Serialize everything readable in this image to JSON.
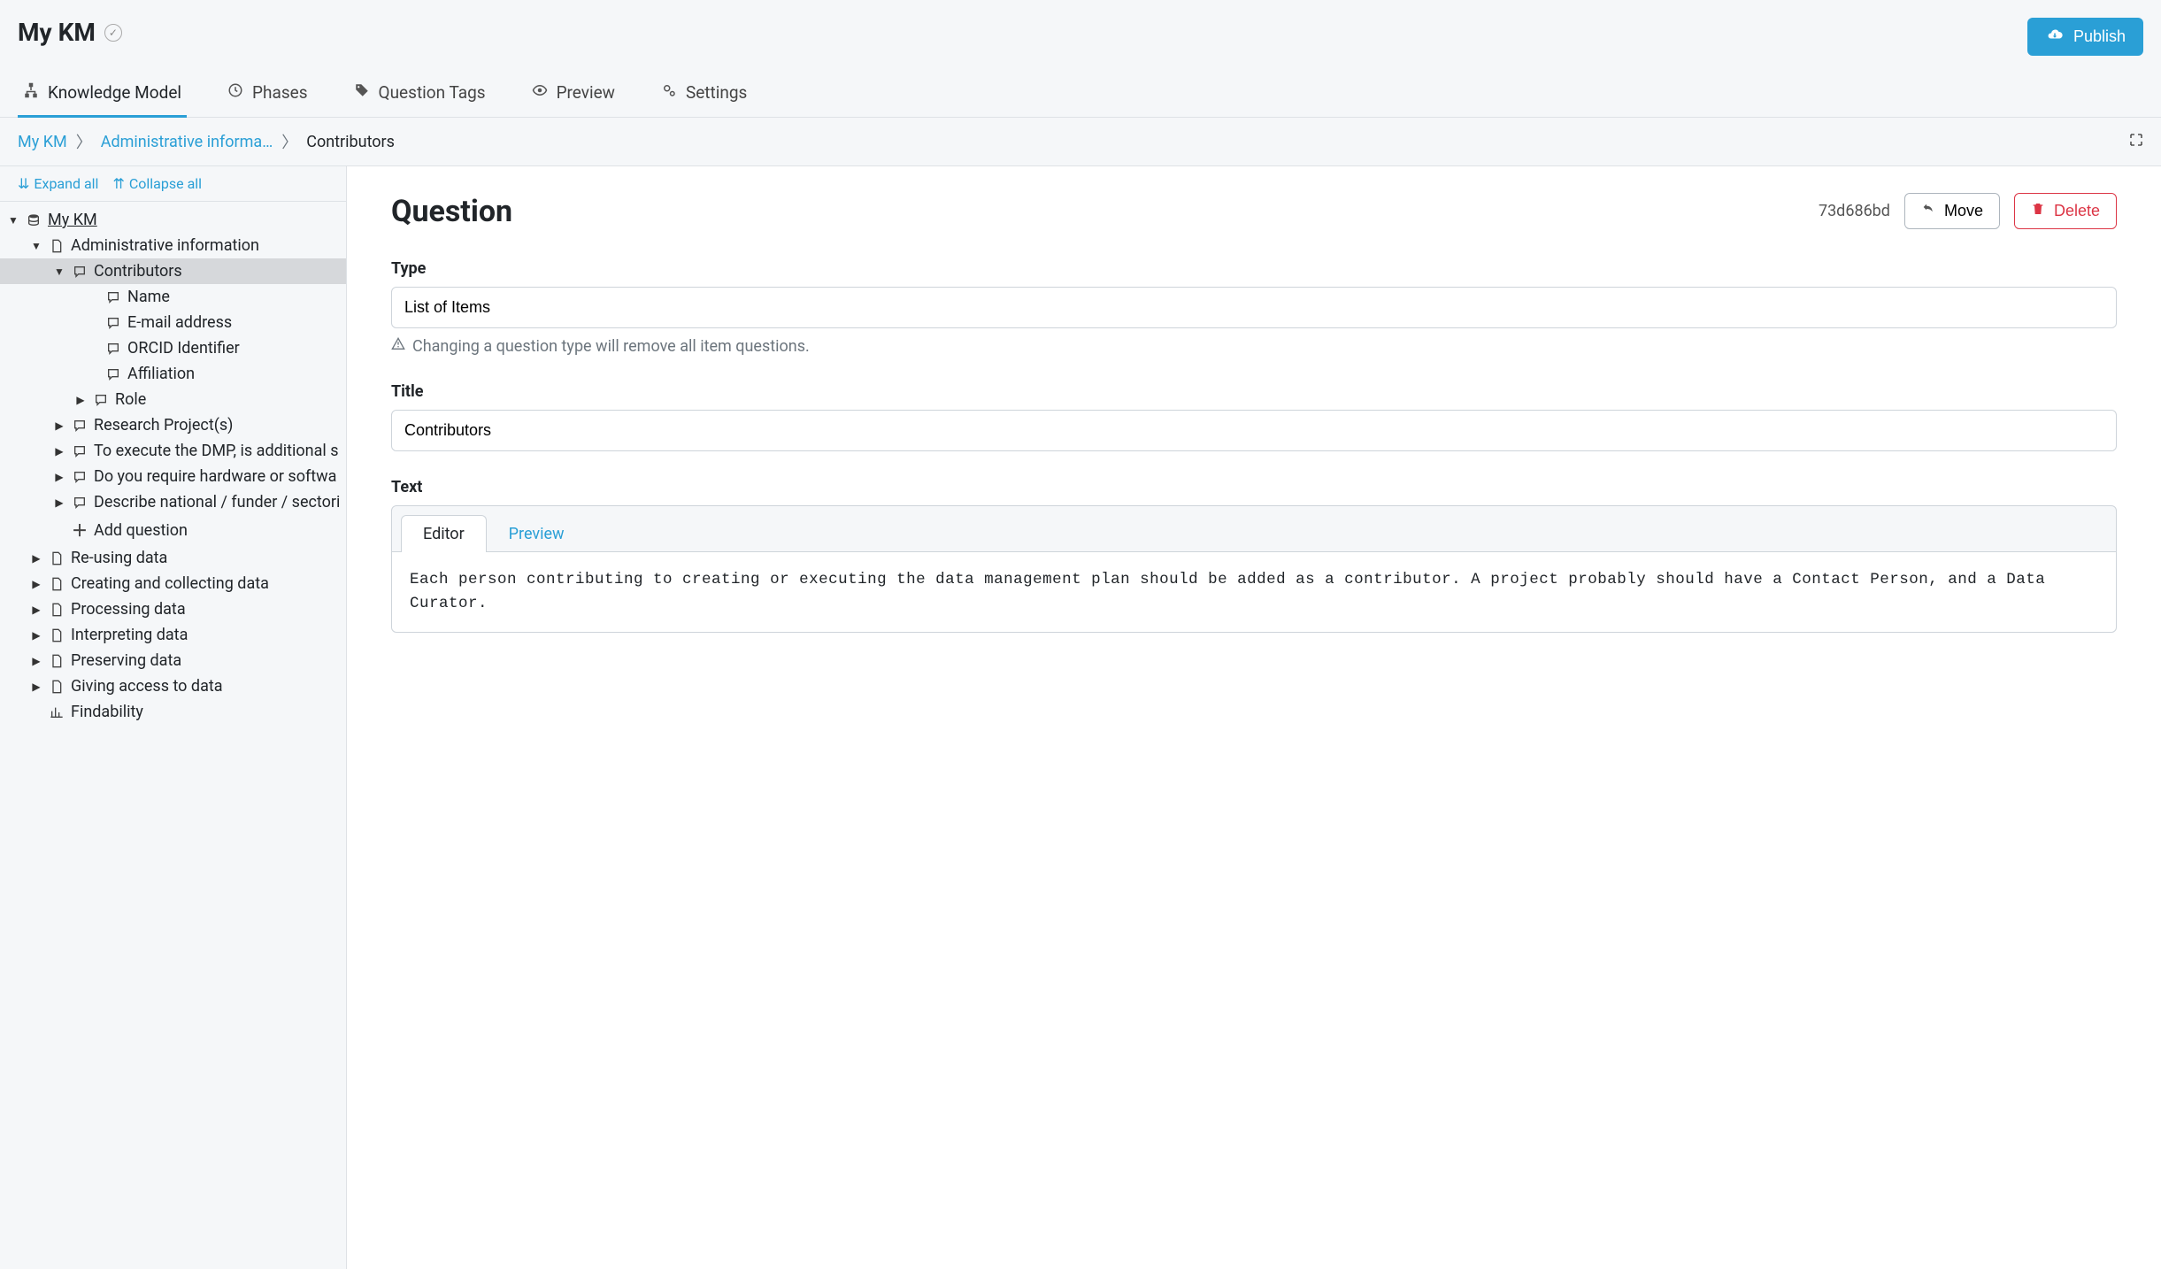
{
  "header": {
    "title": "My KM",
    "publish_label": "Publish"
  },
  "tabs": [
    {
      "id": "km",
      "label": "Knowledge Model",
      "active": true
    },
    {
      "id": "phases",
      "label": "Phases"
    },
    {
      "id": "qtags",
      "label": "Question Tags"
    },
    {
      "id": "preview",
      "label": "Preview"
    },
    {
      "id": "settings",
      "label": "Settings"
    }
  ],
  "breadcrumb": {
    "root": "My KM",
    "mid": "Administrative informa…",
    "current": "Contributors"
  },
  "tree_controls": {
    "expand": "Expand all",
    "collapse": "Collapse all"
  },
  "tree": {
    "root": "My KM",
    "admin": "Administrative information",
    "contributors": "Contributors",
    "contrib_children": [
      "Name",
      "E-mail address",
      "ORCID Identifier",
      "Affiliation"
    ],
    "role": "Role",
    "admin_siblings": [
      "Research Project(s)",
      "To execute the DMP, is additional s",
      "Do you require hardware or softwa",
      "Describe national / funder / sectori"
    ],
    "add_question": "Add question",
    "root_siblings": [
      "Re-using data",
      "Creating and collecting data",
      "Processing data",
      "Interpreting data",
      "Preserving data",
      "Giving access to data"
    ],
    "findability": "Findability"
  },
  "panel": {
    "heading": "Question",
    "uuid": "73d686bd",
    "move_label": "Move",
    "delete_label": "Delete",
    "type_label": "Type",
    "type_value": "List of Items",
    "type_hint": "Changing a question type will remove all item questions.",
    "title_label": "Title",
    "title_value": "Contributors",
    "text_label": "Text",
    "text_tabs": {
      "editor": "Editor",
      "preview": "Preview"
    },
    "text_body": "Each person contributing to creating or executing the data management plan should be added as a contributor. A project probably should have a Contact Person, and a Data Curator."
  }
}
